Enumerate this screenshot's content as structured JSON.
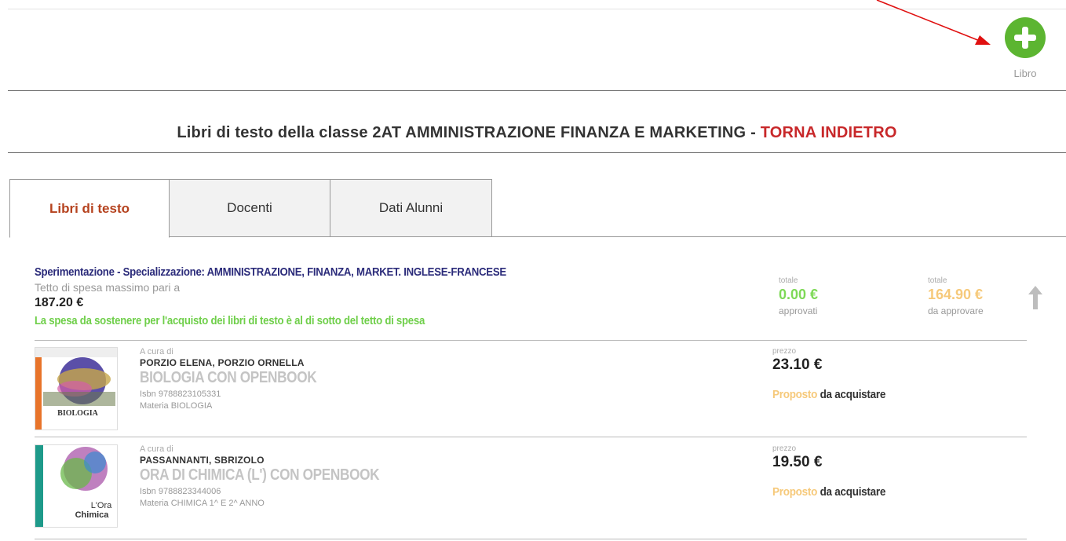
{
  "toolbar": {
    "add_label": "Libro"
  },
  "page": {
    "title_prefix": "Libri di testo della classe 2AT AMMINISTRAZIONE FINANZA E MARKETING - ",
    "back_link": "TORNA INDIETRO"
  },
  "tabs": [
    {
      "label": "Libri di testo",
      "active": true
    },
    {
      "label": "Docenti",
      "active": false
    },
    {
      "label": "Dati Alunni",
      "active": false
    }
  ],
  "section": {
    "specialization": "Sperimentazione - Specializzazione: AMMINISTRAZIONE, FINANZA, MARKET. INGLESE-FRANCESE",
    "cap_label": "Tetto di spesa massimo pari a",
    "cap_value": "187.20 €",
    "cap_message": "La spesa da sostenere per l'acquisto dei libri di testo è al di sotto del tetto di spesa",
    "approved": {
      "label": "totale",
      "value": "0.00 €",
      "sub": "approvati"
    },
    "pending": {
      "label": "totale",
      "value": "164.90 €",
      "sub": "da approvare"
    }
  },
  "books": [
    {
      "curated_label": "A cura di",
      "authors": "PORZIO ELENA, PORZIO ORNELLA",
      "title": "BIOLOGIA CON OPENBOOK",
      "isbn": "Isbn 9788823105331",
      "subject": "Materia BIOLOGIA",
      "price_label": "prezzo",
      "price": "23.10 €",
      "status_proposed": "Proposto",
      "status_action": " da acquistare",
      "cover_text": "BIOLOGIA"
    },
    {
      "curated_label": "A cura di",
      "authors": "PASSANNANTI, SBRIZOLO",
      "title": "ORA DI CHIMICA (L') CON OPENBOOK",
      "isbn": "Isbn 9788823344006",
      "subject": "Materia CHIMICA 1^ E 2^ ANNO",
      "price_label": "prezzo",
      "price": "19.50 €",
      "status_proposed": "Proposto",
      "status_action": " da acquistare",
      "cover_text_1": "L'Ora",
      "cover_text_2": "Chimica"
    }
  ],
  "colors": {
    "accent_red": "#c8282a",
    "approved_green": "#7ed957",
    "pending_orange": "#f6c97a",
    "add_green": "#5cb531"
  }
}
